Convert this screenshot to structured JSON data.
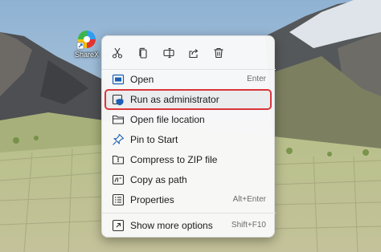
{
  "desktop": {
    "icon_label": "ShareX",
    "icon_name": "sharex-app-icon"
  },
  "context_menu": {
    "quick_actions": [
      {
        "name": "cut-icon"
      },
      {
        "name": "copy-icon"
      },
      {
        "name": "rename-icon"
      },
      {
        "name": "share-icon"
      },
      {
        "name": "delete-icon"
      }
    ],
    "items": [
      {
        "label": "Open",
        "shortcut": "Enter",
        "icon": "open-icon"
      },
      {
        "label": "Run as administrator",
        "shortcut": "",
        "icon": "shield-icon",
        "highlighted": true
      },
      {
        "label": "Open file location",
        "shortcut": "",
        "icon": "folder-icon"
      },
      {
        "label": "Pin to Start",
        "shortcut": "",
        "icon": "pin-icon"
      },
      {
        "label": "Compress to ZIP file",
        "shortcut": "",
        "icon": "zip-icon"
      },
      {
        "label": "Copy as path",
        "shortcut": "",
        "icon": "copy-path-icon"
      },
      {
        "label": "Properties",
        "shortcut": "Alt+Enter",
        "icon": "properties-icon"
      },
      {
        "label": "Show more options",
        "shortcut": "Shift+F10",
        "icon": "more-options-icon"
      }
    ]
  },
  "colors": {
    "highlight_border": "#d9363a",
    "accent_blue": "#1a5fb4"
  }
}
